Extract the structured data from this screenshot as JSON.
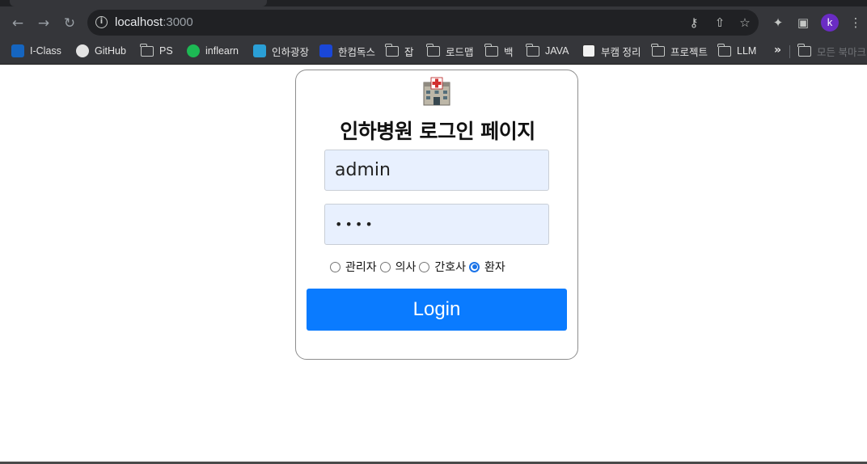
{
  "browser": {
    "url_host": "localhost",
    "url_port": ":3000",
    "profile_initial": "k",
    "bookmarks": [
      {
        "label": "I-Class",
        "icon": "iclass-icon",
        "color": "#1565c0"
      },
      {
        "label": "GitHub",
        "icon": "github-icon",
        "color": "#e3e3e3"
      },
      {
        "label": "PS",
        "icon": "folder-icon"
      },
      {
        "label": "inflearn",
        "icon": "inflearn-icon",
        "color": "#1db954"
      },
      {
        "label": "인하광장",
        "icon": "inha-icon",
        "color": "#2a9fd6"
      },
      {
        "label": "한컴독스",
        "icon": "hancom-icon",
        "color": "#1a47d8"
      },
      {
        "label": "잡",
        "icon": "folder-icon"
      },
      {
        "label": "로드맵",
        "icon": "folder-icon"
      },
      {
        "label": "백",
        "icon": "folder-icon"
      },
      {
        "label": "JAVA",
        "icon": "folder-icon"
      },
      {
        "label": "부캠 정리",
        "icon": "notion-icon"
      },
      {
        "label": "프로젝트",
        "icon": "folder-icon"
      },
      {
        "label": "LLM",
        "icon": "folder-icon"
      }
    ],
    "more_label": "»",
    "other_bookmarks": "모든 북마크"
  },
  "login": {
    "title": "인하병원 로그인 페이지",
    "username_value": "admin",
    "password_mask": "••••",
    "roles": [
      {
        "label": "관리자",
        "checked": false
      },
      {
        "label": "의사",
        "checked": false
      },
      {
        "label": "간호사",
        "checked": false
      },
      {
        "label": "환자",
        "checked": true
      }
    ],
    "button_label": "Login"
  },
  "colors": {
    "accent": "#0a7bff",
    "input_bg": "#e8f0fe",
    "chrome_bg": "#35363a"
  }
}
